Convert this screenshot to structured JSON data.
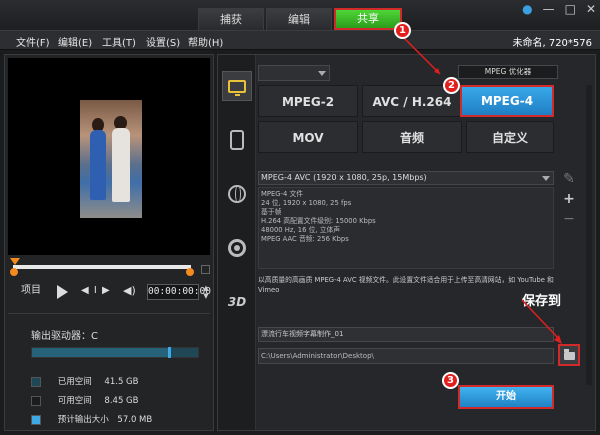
{
  "tabs": [
    {
      "label": "捕获"
    },
    {
      "label": "编辑"
    },
    {
      "label": "共享"
    }
  ],
  "window": {
    "help": "●",
    "minimize": "—",
    "maximize": "□",
    "close": "✕"
  },
  "menu": {
    "items": [
      "文件(F)",
      "编辑(E)",
      "工具(T)",
      "设置(S)",
      "帮助(H)"
    ],
    "project_info": "未命名, 720*576"
  },
  "player": {
    "project_label": "项目",
    "step_controls": "◀ I ▶",
    "volume": "◀)",
    "timecode": "00:00:00:00",
    "spin": "▲▼"
  },
  "drive": {
    "label": "输出驱动器：C",
    "used_fraction": 0.82,
    "legend": [
      {
        "label": "已用空间",
        "value": "41.5 GB",
        "color": "#1f4756"
      },
      {
        "label": "可用空间",
        "value": "8.45 GB",
        "color": "#1b1c1e"
      },
      {
        "label": "预计输出大小",
        "value": "57.0 MB",
        "color": "#3fa9e6"
      }
    ]
  },
  "share": {
    "optimizer_label": "MPEG 优化器",
    "formats": [
      "MPEG-2",
      "AVC / H.264",
      "MPEG-4",
      "MOV",
      "音频",
      "自定义"
    ],
    "selected_format": "MPEG-4",
    "profile": "MPEG-4 AVC (1920 x 1080, 25p, 15Mbps)",
    "details": [
      "MPEG-4 文件",
      "24 位, 1920 x 1080, 25 fps",
      "基于帧",
      "H.264 高配置文件级别: 15000 Kbps",
      "48000 Hz, 16 位, 立体声",
      "MPEG AAC 音频: 256 Kbps"
    ],
    "description": "以高质量的高画质 MPEG-4 AVC 视频文件。此设置文件适合用于上传至高清网站，如 YouTube 和 Vimeo",
    "filename": "漂流行车视频字幕制作_01",
    "path": "C:\\Users\\Administrator\\Desktop\\",
    "save_to": "保存到",
    "start_label": "开始",
    "tools": [
      "✎",
      "+",
      "−"
    ]
  },
  "annotations": [
    "1",
    "2",
    "3"
  ],
  "colors": {
    "accent_green": "#3bb52a",
    "accent_blue": "#2b95d8",
    "highlight_red": "#d12a2a"
  }
}
